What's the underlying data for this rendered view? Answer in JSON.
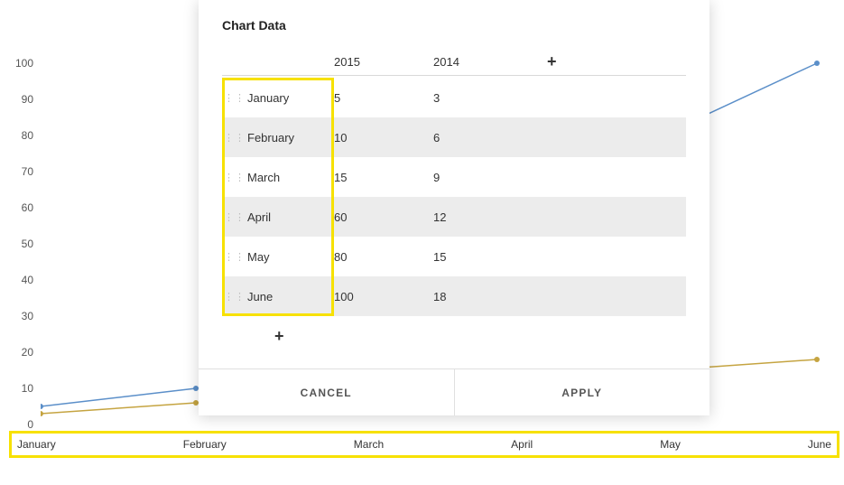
{
  "dialog": {
    "title": "Chart Data",
    "columns": [
      "2015",
      "2014"
    ],
    "rows": [
      {
        "label": "January",
        "a": "5",
        "b": "3"
      },
      {
        "label": "February",
        "a": "10",
        "b": "6"
      },
      {
        "label": "March",
        "a": "15",
        "b": "9"
      },
      {
        "label": "April",
        "a": "60",
        "b": "12"
      },
      {
        "label": "May",
        "a": "80",
        "b": "15"
      },
      {
        "label": "June",
        "a": "100",
        "b": "18"
      }
    ],
    "add_icon": "+",
    "cancel_label": "CANCEL",
    "apply_label": "APPLY"
  },
  "axes": {
    "y": [
      "100",
      "90",
      "80",
      "70",
      "60",
      "50",
      "40",
      "30",
      "20",
      "10",
      "0"
    ],
    "x": [
      "January",
      "February",
      "March",
      "April",
      "May",
      "June"
    ]
  },
  "chart_data": {
    "type": "line",
    "categories": [
      "January",
      "February",
      "March",
      "April",
      "May",
      "June"
    ],
    "series": [
      {
        "name": "2015",
        "color": "#5b8fc9",
        "values": [
          5,
          10,
          15,
          60,
          80,
          100
        ]
      },
      {
        "name": "2014",
        "color": "#c5a441",
        "values": [
          3,
          6,
          9,
          12,
          15,
          18
        ]
      }
    ],
    "ylim": [
      0,
      100
    ],
    "y_ticks": [
      0,
      10,
      20,
      30,
      40,
      50,
      60,
      70,
      80,
      90,
      100
    ]
  },
  "highlight": {
    "row_labels": true,
    "x_axis": true,
    "color": "#f7e100"
  }
}
